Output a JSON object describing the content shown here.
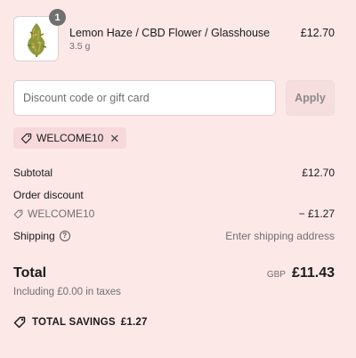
{
  "cart": {
    "item": {
      "quantity": "1",
      "name": "Lemon Haze / CBD Flower / Glasshouse",
      "variant": "3.5 g",
      "price": "£12.70",
      "image_icon": "cbd-flower-bud-icon"
    }
  },
  "discount": {
    "placeholder": "Discount code or gift card",
    "value": "",
    "apply_label": "Apply",
    "applied_code": "WELCOME10",
    "remove_symbol": "✕"
  },
  "summary": {
    "subtotal_label": "Subtotal",
    "subtotal_value": "£12.70",
    "order_discount_label": "Order discount",
    "discount_code": "WELCOME10",
    "discount_value": "− £1.27",
    "shipping_label": "Shipping",
    "shipping_info_symbol": "?",
    "shipping_value": "Enter shipping address",
    "total_label": "Total",
    "currency": "GBP",
    "total_value": "£11.43",
    "taxes_note": "Including £0.00 in taxes",
    "savings_label": "TOTAL SAVINGS",
    "savings_value": "£1.27"
  },
  "colors": {
    "background": "#fde8e8",
    "chip_background": "#f7d9d9",
    "muted_text": "#707070"
  }
}
